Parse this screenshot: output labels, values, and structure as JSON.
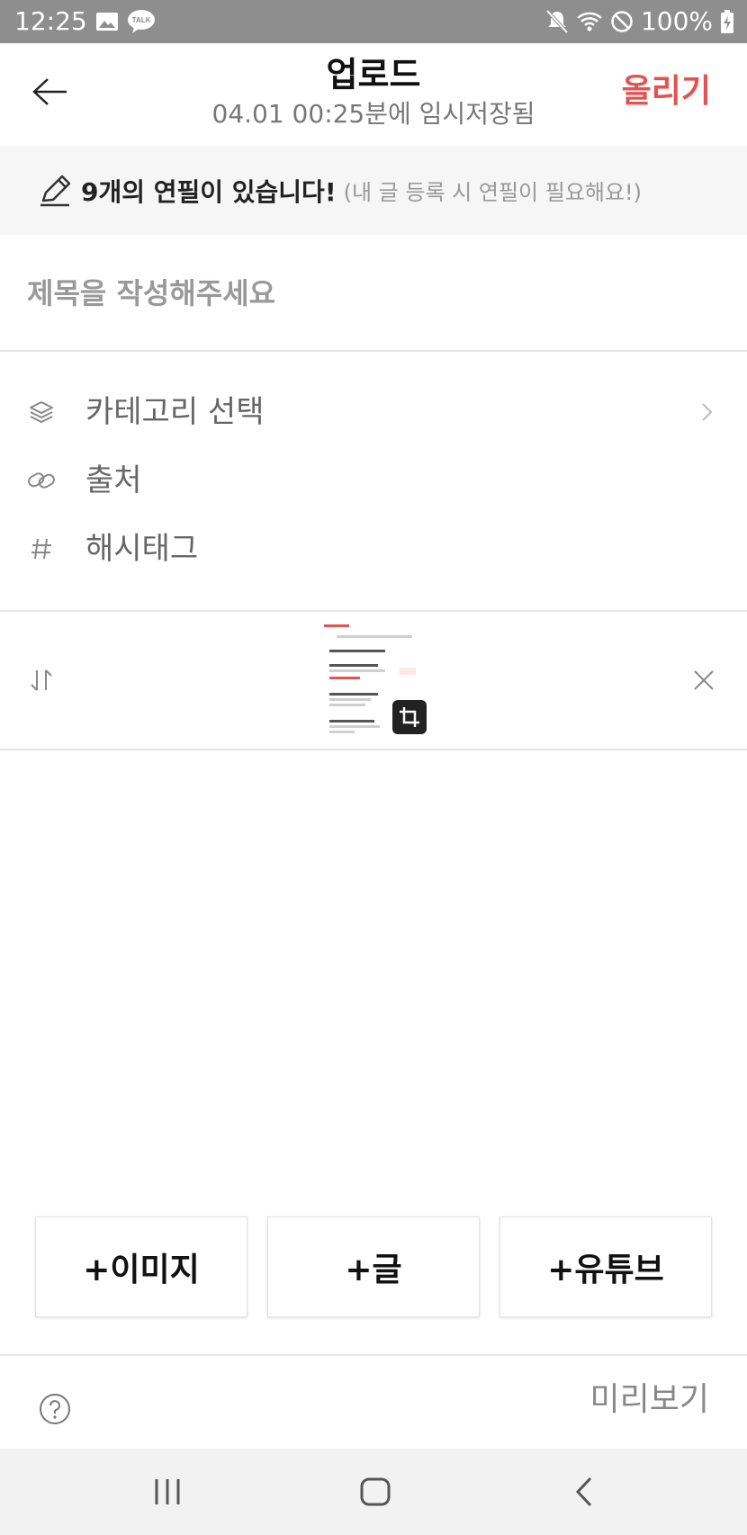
{
  "status_bar": {
    "time": "12:25",
    "talk_label": "TALK",
    "battery": "100%"
  },
  "header": {
    "title": "업로드",
    "subtitle": "04.01 00:25분에 임시저장됨",
    "upload_label": "올리기"
  },
  "pencil_banner": {
    "count_text": "9개의 연필이 있습니다!",
    "hint_text": "(내 글 등록 시 연필이 필요해요!)"
  },
  "title_field": {
    "placeholder": "제목을 작성해주세요"
  },
  "meta": {
    "category_label": "카테고리 선택",
    "source_label": "출처",
    "hashtag_label": "해시태그"
  },
  "add_buttons": {
    "image_label": "+이미지",
    "text_label": "+글",
    "youtube_label": "+유튜브"
  },
  "footer": {
    "preview_label": "미리보기"
  },
  "colors": {
    "accent": "#e25451",
    "status_bar": "#8e8e8e",
    "banner_bg": "#f6f6f6"
  },
  "icons": {
    "back": "arrow-left-icon",
    "pencil": "pencil-icon",
    "category": "layers-icon",
    "source": "link-icon",
    "hashtag": "hashtag-icon",
    "reorder": "sort-icon",
    "remove": "close-icon",
    "crop": "crop-icon",
    "help": "question-icon"
  }
}
